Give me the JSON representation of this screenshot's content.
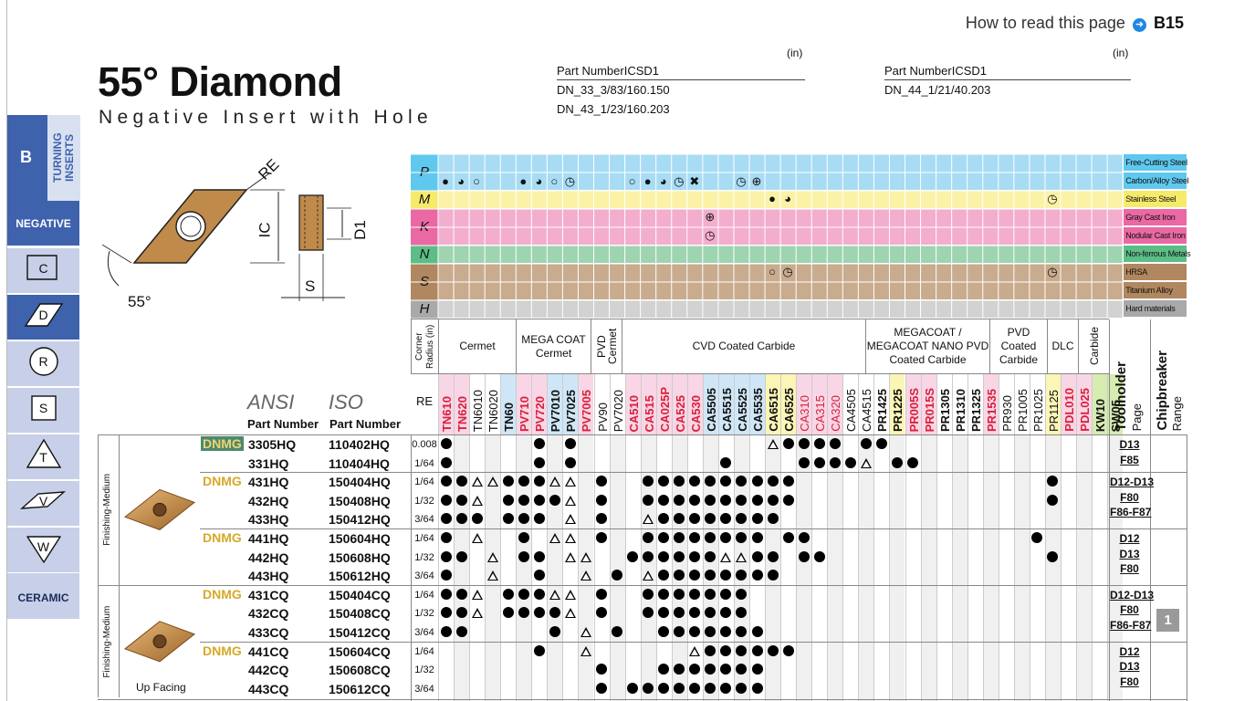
{
  "page": {
    "how_to_read": "How to read this page",
    "how_ref": "B15",
    "title": "55° Diamond",
    "subtitle": "Negative Insert with Hole"
  },
  "dim_tables": [
    {
      "unit": "(in)",
      "headers": [
        "Part Number",
        "IC",
        "S",
        "D1"
      ],
      "rows": [
        [
          "DN_33_",
          "3/8",
          "3/16",
          "0.150"
        ],
        [
          "DN_43_",
          "1/2",
          "3/16",
          "0.203"
        ]
      ]
    },
    {
      "unit": "(in)",
      "headers": [
        "Part Number",
        "IC",
        "S",
        "D1"
      ],
      "rows": [
        [
          "DN_44_",
          "1/2",
          "1/4",
          "0.203"
        ]
      ]
    }
  ],
  "sidebar": {
    "letter": "B",
    "section": "TURNING INSERTS",
    "negative": "NEGATIVE",
    "shapes": [
      "C",
      "D",
      "R",
      "S",
      "T",
      "V",
      "W"
    ],
    "ceramic": "CERAMIC"
  },
  "diagram": {
    "re": "RE",
    "ic": "IC",
    "d1": "D1",
    "s": "S",
    "angle": "55°"
  },
  "materials": [
    {
      "letter": "P",
      "color": "#5fc8ef",
      "light": "#a8dcf4",
      "labels": [
        "Free-Cutting Steel",
        "Carbon/Alloy Steel"
      ]
    },
    {
      "letter": "M",
      "color": "#f6ea6b",
      "light": "#fbf2a8",
      "labels": [
        "Stainless Steel"
      ]
    },
    {
      "letter": "K",
      "color": "#ea68a3",
      "light": "#f3aece",
      "labels": [
        "Gray Cast Iron",
        "Nodular Cast Iron"
      ]
    },
    {
      "letter": "N",
      "color": "#5cbd86",
      "light": "#9ed4b0",
      "labels": [
        "Non-ferrous Metals"
      ]
    },
    {
      "letter": "S",
      "color": "#b0875f",
      "light": "#c9ab8e",
      "labels": [
        "HRSA",
        "Titanium Alloy"
      ]
    },
    {
      "letter": "H",
      "color": "#a9a9a9",
      "light": "#d2d2d2",
      "labels": [
        "Hard materials"
      ]
    }
  ],
  "group_headers": [
    {
      "text": "Corner Radius (in)",
      "vertical": true
    },
    {
      "text": "Cermet"
    },
    {
      "text": "MEGA COAT Cermet"
    },
    {
      "text": "PVD Cermet",
      "vertical": true
    },
    {
      "text": "CVD Coated Carbide"
    },
    {
      "text": "MEGACOAT / MEGACOAT NANO PVD Coated Carbide"
    },
    {
      "text": "PVD Coated Carbide"
    },
    {
      "text": "DLC"
    },
    {
      "text": "Carbide",
      "vertical": true
    }
  ],
  "grades": [
    {
      "name": "TN610",
      "red": true,
      "bold": true
    },
    {
      "name": "TN620",
      "red": true,
      "bold": true
    },
    {
      "name": "TN6010"
    },
    {
      "name": "TN6020"
    },
    {
      "name": "TN60",
      "bold": true
    },
    {
      "name": "PV710",
      "red": true,
      "bold": true
    },
    {
      "name": "PV720",
      "red": true,
      "bold": true
    },
    {
      "name": "PV7010",
      "bold": true
    },
    {
      "name": "PV7025",
      "bold": true
    },
    {
      "name": "PV7005",
      "red": true,
      "bold": true
    },
    {
      "name": "PV90"
    },
    {
      "name": "PV7020"
    },
    {
      "name": "CA510",
      "red": true,
      "bold": true
    },
    {
      "name": "CA515",
      "red": true,
      "bold": true
    },
    {
      "name": "CA025P",
      "red": true,
      "bold": true
    },
    {
      "name": "CA525",
      "red": true,
      "bold": true
    },
    {
      "name": "CA530",
      "red": true,
      "bold": true
    },
    {
      "name": "CA5505",
      "bold": true
    },
    {
      "name": "CA5515",
      "bold": true
    },
    {
      "name": "CA5525",
      "bold": true
    },
    {
      "name": "CA5535",
      "bold": true
    },
    {
      "name": "CA6515",
      "bold": true
    },
    {
      "name": "CA6525",
      "bold": true
    },
    {
      "name": "CA310",
      "red": true
    },
    {
      "name": "CA315",
      "red": true
    },
    {
      "name": "CA320",
      "red": true
    },
    {
      "name": "CA4505"
    },
    {
      "name": "CA4515"
    },
    {
      "name": "PR1425",
      "bold": true
    },
    {
      "name": "PR1225",
      "bold": true
    },
    {
      "name": "PR005S",
      "red": true,
      "bold": true
    },
    {
      "name": "PR015S",
      "red": true,
      "bold": true
    },
    {
      "name": "PR1305",
      "bold": true
    },
    {
      "name": "PR1310",
      "bold": true
    },
    {
      "name": "PR1325",
      "bold": true
    },
    {
      "name": "PR1535",
      "red": true,
      "bold": true
    },
    {
      "name": "PR930"
    },
    {
      "name": "PR1005"
    },
    {
      "name": "PR1025"
    },
    {
      "name": "PR1125"
    },
    {
      "name": "PDL010",
      "red": true,
      "bold": true
    },
    {
      "name": "PDL025",
      "red": true,
      "bold": true
    },
    {
      "name": "KW10",
      "bold": true
    },
    {
      "name": "SW05",
      "bold": true
    }
  ],
  "table_head": {
    "re": "RE",
    "ansi": "ANSI",
    "iso": "ISO",
    "part_number": "Part Number",
    "toolholder": "Toolholder",
    "toolholder_sub": "Page",
    "chipbreaker": "Chipbreaker",
    "chipbreaker_sub": "Range"
  },
  "sections": [
    {
      "label": "Finishing-Medium",
      "note": ""
    },
    {
      "label": "Finishing-Medium",
      "note": "Up Facing"
    }
  ],
  "rows": [
    {
      "prefix": "DNMG",
      "ansi": "3305HQ",
      "iso": "110402HQ",
      "re": "0.008",
      "links": [
        "D13",
        "F85"
      ],
      "marks": "●.....●.●............△●●●●.●●........................"
    },
    {
      "prefix": "",
      "ansi": "331HQ",
      "iso": "110404HQ",
      "re": "1/64",
      "links": [],
      "marks": "●.....●.●.........●....●●●●△.●●........................"
    },
    {
      "prefix": "DNMG",
      "ansi": "431HQ",
      "iso": "150404HQ",
      "re": "1/64",
      "links": [
        "D12-D13",
        "F80",
        "F86-F87"
      ],
      "marks": "●●△△●●●△△.●..●●●●●●●●●●................●...."
    },
    {
      "prefix": "",
      "ansi": "432HQ",
      "iso": "150408HQ",
      "re": "1/32",
      "links": [],
      "marks": "●●△.●●●●△.●..●●●●●●●●●●................●...."
    },
    {
      "prefix": "",
      "ansi": "433HQ",
      "iso": "150412HQ",
      "re": "3/64",
      "links": [],
      "marks": "●●●.●●●.△.●..△●●●●●●●●................................"
    },
    {
      "prefix": "DNMG",
      "ansi": "441HQ",
      "iso": "150604HQ",
      "re": "1/64",
      "links": [
        "D12",
        "D13",
        "F80"
      ],
      "marks": "●.△..●.△△.●..●●●●●●●●.●●..............●...."
    },
    {
      "prefix": "",
      "ansi": "442HQ",
      "iso": "150608HQ",
      "re": "1/32",
      "links": [],
      "marks": "●●.△.●●.△△..●●●●●●△△●●.●●..............●...."
    },
    {
      "prefix": "",
      "ansi": "443HQ",
      "iso": "150612HQ",
      "re": "3/64",
      "links": [],
      "marks": "●..△..●..△.●.△●●●●●●●●......................"
    },
    {
      "prefix": "DNMG",
      "ansi": "431CQ",
      "iso": "150404CQ",
      "re": "1/64",
      "links": [
        "D12-D13",
        "F80",
        "F86-F87"
      ],
      "marks": "●●△.●●●△△.●..●●●●●●●..........................."
    },
    {
      "prefix": "",
      "ansi": "432CQ",
      "iso": "150408CQ",
      "re": "1/32",
      "links": [],
      "marks": "●●△.●●●●△.●..●●●●●●●..........................."
    },
    {
      "prefix": "",
      "ansi": "433CQ",
      "iso": "150412CQ",
      "re": "3/64",
      "links": [],
      "marks": "●●.....●.△.●..●●●●●●●..........................."
    },
    {
      "prefix": "DNMG",
      "ansi": "441CQ",
      "iso": "150604CQ",
      "re": "1/64",
      "links": [
        "D12",
        "D13",
        "F80"
      ],
      "marks": "......●..△......△●●●●●●..........................."
    },
    {
      "prefix": "",
      "ansi": "442CQ",
      "iso": "150608CQ",
      "re": "1/32",
      "links": [],
      "marks": "..........●...●●●●●●●..........................."
    },
    {
      "prefix": "",
      "ansi": "443CQ",
      "iso": "150612CQ",
      "re": "3/64",
      "links": [],
      "marks": "..........●.●●●●●●●●●..........................."
    }
  ],
  "chipbreaker_badge": "1"
}
